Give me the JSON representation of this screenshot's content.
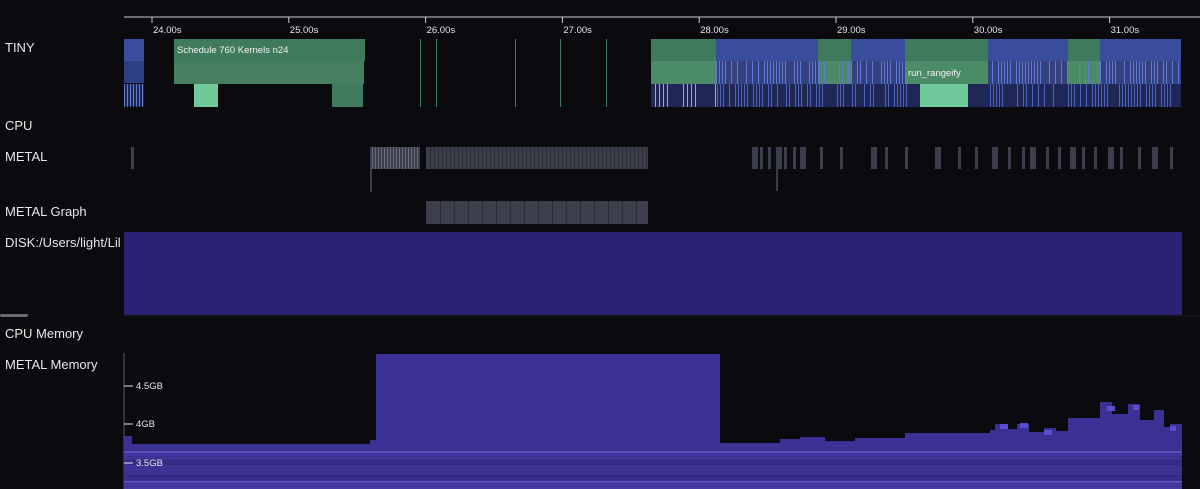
{
  "timeline": {
    "ticks": [
      "24.00s",
      "25.00s",
      "26.00s",
      "27.00s",
      "28.00s",
      "29.00s",
      "30.00s",
      "31.00s"
    ],
    "tick_values": [
      24,
      25,
      26,
      27,
      28,
      29,
      30,
      31
    ],
    "range": [
      23.82,
      31.55
    ]
  },
  "tracks": {
    "tiny": "TINY",
    "cpu": "CPU",
    "metal": "METAL",
    "metal_graph": "METAL Graph",
    "disk": "DISK:/Users/light/Lil",
    "cpu_memory": "CPU Memory",
    "metal_memory": "METAL Memory"
  },
  "spans": {
    "schedule": "Schedule 760 Kernels n24",
    "rangeify": "run_rangeify"
  },
  "memory_axis": {
    "labels": [
      "4.5GB",
      "4GB",
      "3.5GB"
    ],
    "values": [
      4.5,
      4.0,
      3.5
    ]
  },
  "colors": {
    "background": "#0a0a0f",
    "green_span": "#3f7a5c",
    "green_light": "#6fc99a",
    "blue_span": "#3a4c9c",
    "metal_bar": "#3c3f4b",
    "disk_fill": "#2a2272",
    "memory_fill": "#3b3194"
  }
}
